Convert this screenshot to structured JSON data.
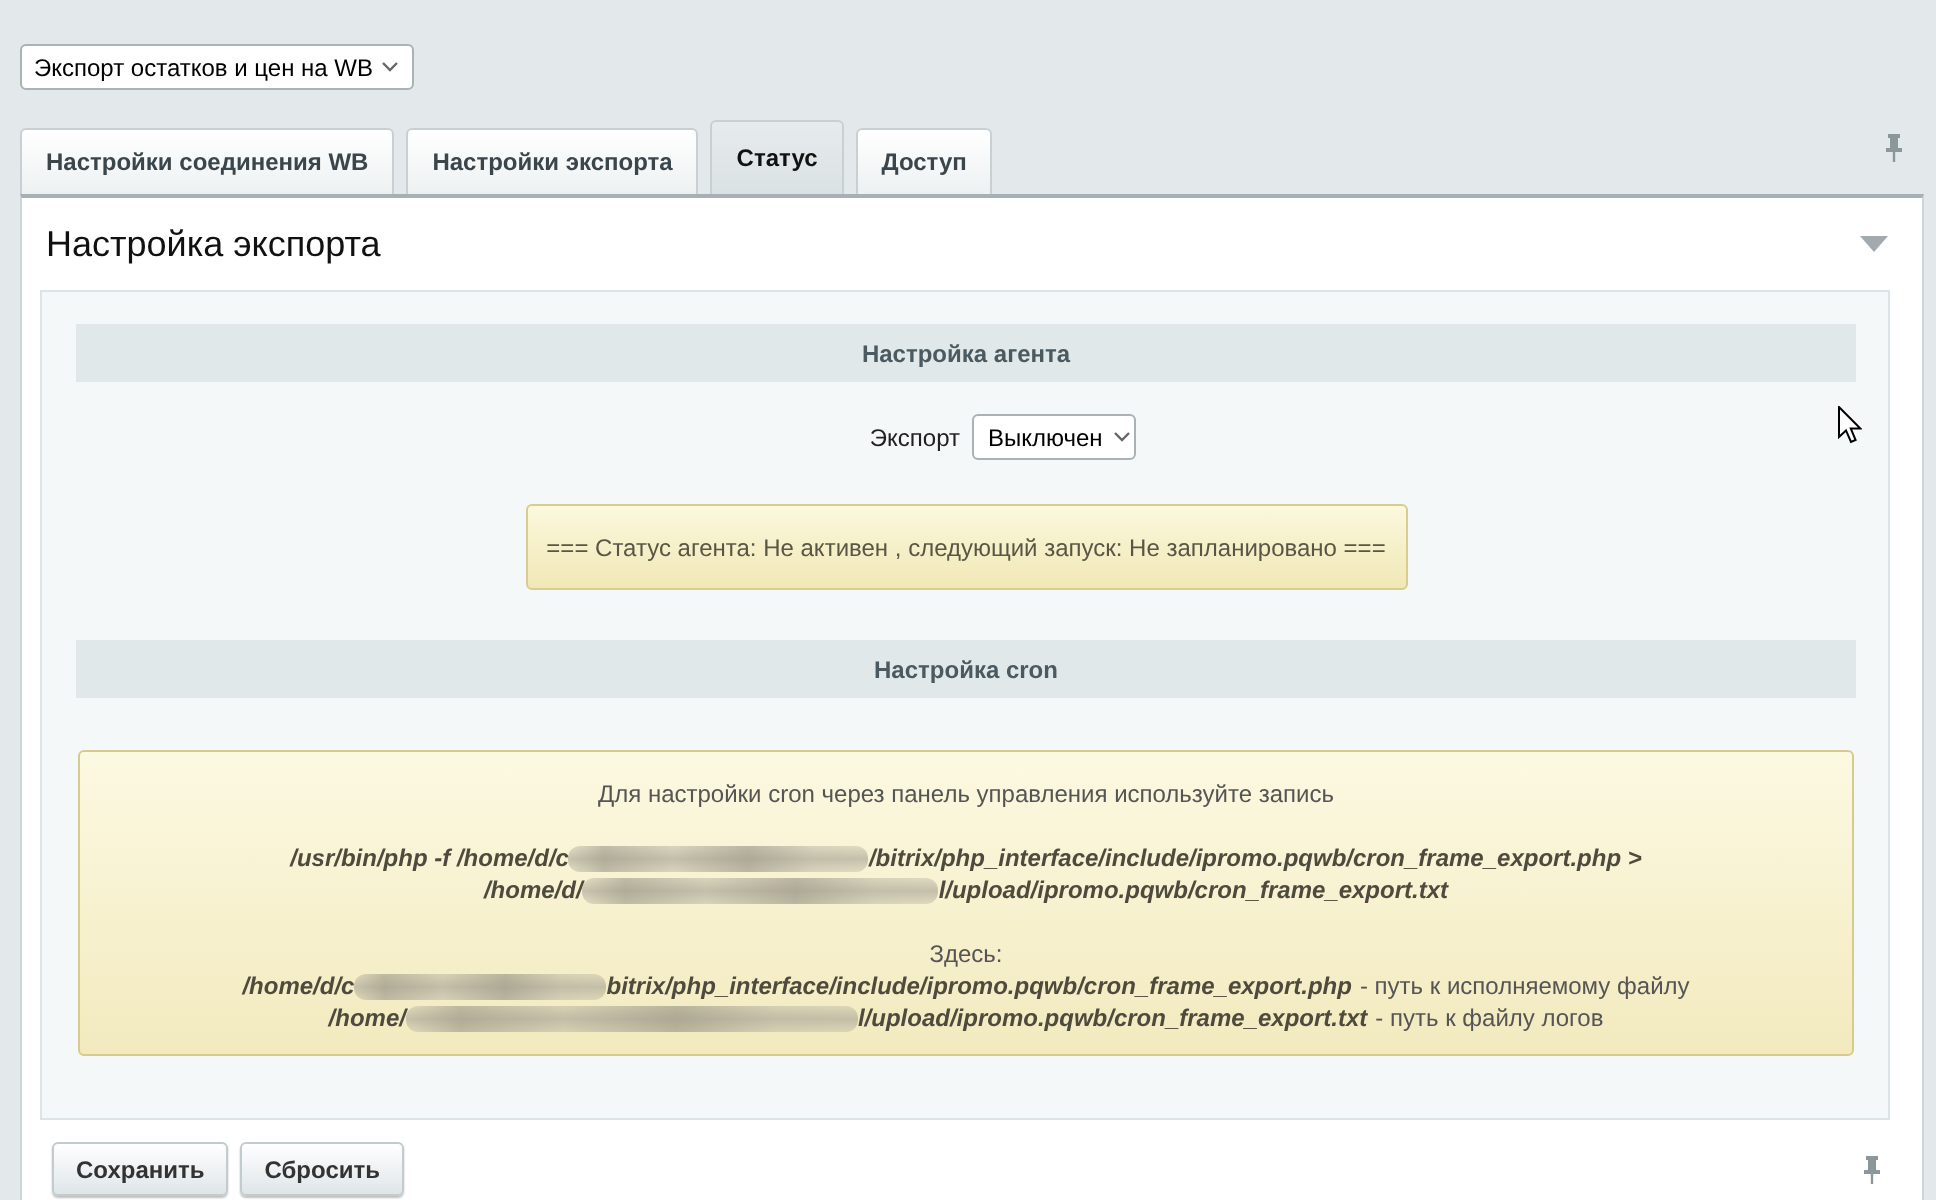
{
  "export_profile_select": {
    "value": "Экспорт остатков и цен на WB"
  },
  "tabs": [
    {
      "label": "Настройки соединения WB",
      "selected": false
    },
    {
      "label": "Настройки экспорта",
      "selected": false
    },
    {
      "label": "Статус",
      "selected": true
    },
    {
      "label": "Доступ",
      "selected": false
    }
  ],
  "panel": {
    "title": "Настройка экспорта",
    "sections": [
      {
        "kind": "agent",
        "heading": "Настройка агента",
        "export_field": {
          "label": "Экспорт",
          "value": "Выключен"
        },
        "status_message": "=== Статус агента: Не активен , следующий запуск: Не запланировано ==="
      },
      {
        "kind": "cron",
        "heading": "Настройка cron",
        "note": {
          "intro": "Для настройки cron через панель управления используйте запись",
          "command_lines": [
            {
              "before": "/usr/bin/php -f /home/d/c",
              "after": "/bitrix/php_interface/include/ipromo.pqwb/cron_frame_export.php >"
            },
            {
              "before": "/home/d/",
              "after": "l/upload/ipromo.pqwb/cron_frame_export.txt"
            }
          ],
          "here_label": "Здесь:",
          "paths": [
            {
              "before": "/home/d/c",
              "after": "bitrix/php_interface/include/ipromo.pqwb/cron_frame_export.php",
              "description": "- путь к исполняемому файлу"
            },
            {
              "before": "/home/",
              "after": "l/upload/ipromo.pqwb/cron_frame_export.txt",
              "description": "- путь к файлу логов"
            }
          ]
        }
      }
    ]
  },
  "buttons": [
    {
      "label": "Сохранить"
    },
    {
      "label": "Сбросить"
    }
  ]
}
